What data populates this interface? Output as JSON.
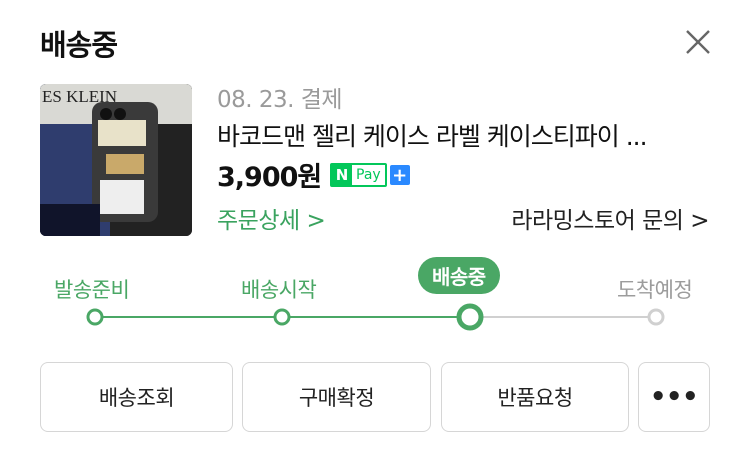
{
  "header": {
    "title": "배송중"
  },
  "order": {
    "date": "08. 23. 결제",
    "product_name": "바코드맨 젤리 케이스 라벨 케이스티파이 ...",
    "price": "3,900원",
    "npay": {
      "n": "N",
      "pay": "Pay",
      "plus": "+"
    },
    "detail_link": "주문상세 >",
    "store_link": "라라밍스토어 문의 >",
    "thumbnail_text": "ES KLEIN"
  },
  "progress": {
    "steps": [
      "발송준비",
      "배송시작",
      "배송중",
      "도착예정"
    ],
    "current_step": 3
  },
  "actions": {
    "track": "배송조회",
    "confirm": "구매확정",
    "return": "반품요청",
    "more": "•••"
  },
  "colors": {
    "green": "#4aa765",
    "gray": "#d0d0d0",
    "npay_green": "#03c75a",
    "npay_blue": "#2a89ff"
  }
}
